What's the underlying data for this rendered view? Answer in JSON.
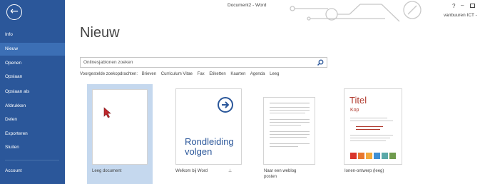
{
  "window": {
    "title": "Document2 - Word",
    "help_label": "?",
    "minimize_label": "–",
    "user": "vanbuuren ICT -"
  },
  "sidebar": {
    "back_icon": "arrow-left-icon",
    "items": [
      {
        "label": "Info"
      },
      {
        "label": "Nieuw",
        "active": true
      },
      {
        "label": "Openen"
      },
      {
        "label": "Opslaan"
      },
      {
        "label": "Opslaan als"
      },
      {
        "label": "Afdrukken"
      },
      {
        "label": "Delen"
      },
      {
        "label": "Exporteren"
      },
      {
        "label": "Sluiten"
      },
      {
        "label": "Account"
      }
    ]
  },
  "main": {
    "heading": "Nieuw",
    "search": {
      "placeholder": "Onlinesjablonen zoeken",
      "icon": "search-icon"
    },
    "suggested": {
      "label": "Voorgestelde zoekopdrachten:",
      "items": [
        "Brieven",
        "Curriculum Vitae",
        "Fax",
        "Etiketten",
        "Kaarten",
        "Agenda",
        "Leeg"
      ]
    },
    "templates": [
      {
        "label": "Leeg document"
      },
      {
        "label": "Welkom bij Word",
        "thumb_text": "Rondleiding volgen",
        "pin_label": "⊥"
      },
      {
        "label": "Naar een weblog posten"
      },
      {
        "label": "Ionen-ontwerp (leeg)",
        "thumb_title": "Titel",
        "thumb_subtitle": "Kop"
      }
    ],
    "ion_swatches": [
      "#d9342b",
      "#e8772e",
      "#f2a93b",
      "#3f8fd3",
      "#5aa9a8",
      "#6f9b4d"
    ]
  }
}
